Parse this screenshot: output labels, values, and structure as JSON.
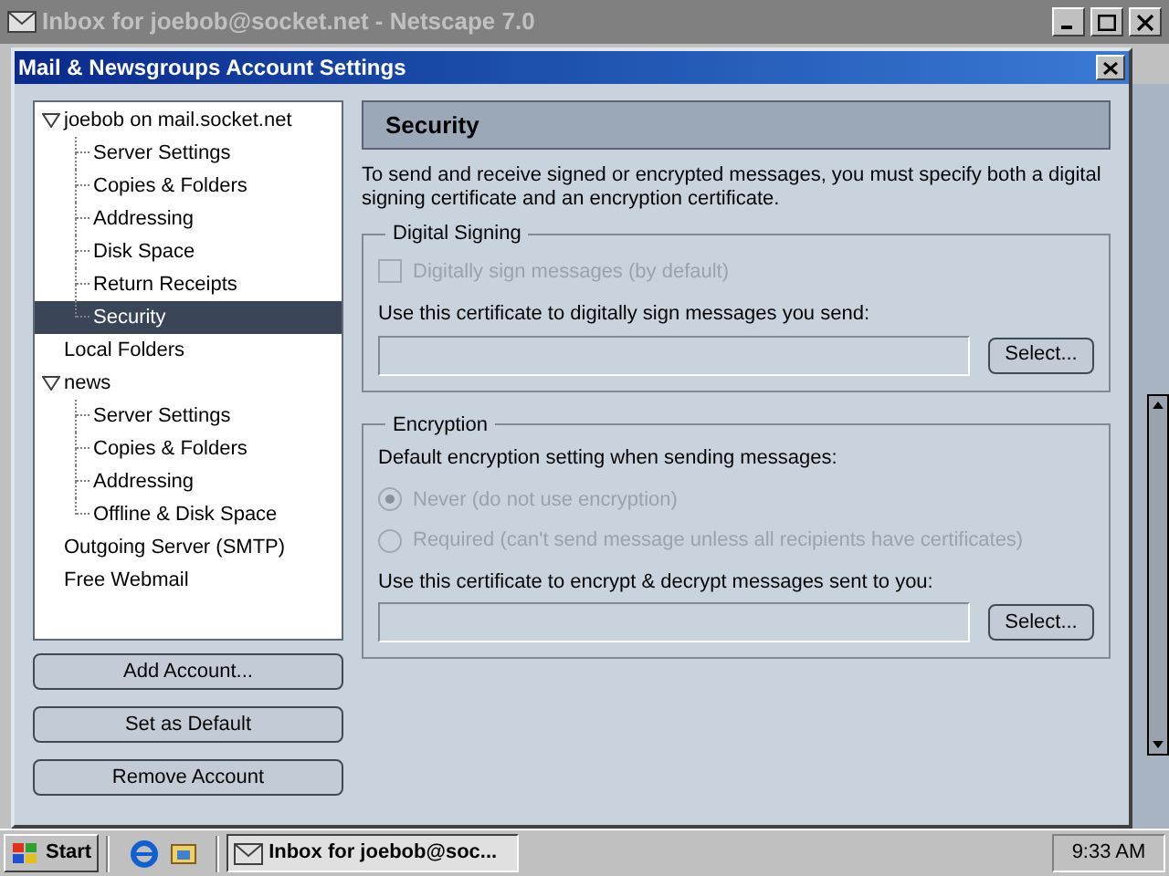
{
  "window": {
    "title": "Inbox for joebob@socket.net - Netscape 7.0"
  },
  "dialog": {
    "title": "Mail & Newsgroups Account Settings"
  },
  "tree": [
    {
      "label": "joebob on mail.socket.net",
      "expanded": true,
      "selected": false,
      "children": [
        {
          "label": "Server Settings",
          "selected": false
        },
        {
          "label": "Copies & Folders",
          "selected": false
        },
        {
          "label": "Addressing",
          "selected": false
        },
        {
          "label": "Disk Space",
          "selected": false
        },
        {
          "label": "Return Receipts",
          "selected": false
        },
        {
          "label": "Security",
          "selected": true
        }
      ]
    },
    {
      "label": "Local Folders",
      "selected": false
    },
    {
      "label": "news",
      "expanded": true,
      "selected": false,
      "children": [
        {
          "label": "Server Settings",
          "selected": false
        },
        {
          "label": "Copies & Folders",
          "selected": false
        },
        {
          "label": "Addressing",
          "selected": false
        },
        {
          "label": "Offline & Disk Space",
          "selected": false
        }
      ]
    },
    {
      "label": "Outgoing Server (SMTP)",
      "selected": false
    },
    {
      "label": "Free Webmail",
      "selected": false
    }
  ],
  "buttons": [
    "Add Account...",
    "Set as Default",
    "Remove Account"
  ],
  "panel": {
    "title": "Security",
    "intro": "To send and receive signed or encrypted messages, you must specify both a digital signing certificate and an encryption certificate.",
    "signing": {
      "legend": "Digital Signing",
      "checkbox": {
        "label": "Digitally sign messages (by default)",
        "checked": false,
        "disabled": true
      },
      "cert_label": "Use this certificate to digitally sign messages you send:",
      "button": "Select..."
    },
    "encryption": {
      "legend": "Encryption",
      "prompt": "Default encryption setting when sending messages:",
      "options": [
        {
          "label": "Never (do not use encryption)",
          "selected": true,
          "disabled": true
        },
        {
          "label": "Required (can't send message unless all recipients have certificates)",
          "selected": false,
          "disabled": true
        }
      ],
      "cert_label": "Use this certificate to encrypt & decrypt messages sent to you:",
      "button": "Select..."
    }
  },
  "taskbar": {
    "start": "Start",
    "tasks": [
      {
        "label": "Inbox for joebob@soc...",
        "selected": true
      }
    ],
    "clock": "9:33 AM"
  }
}
